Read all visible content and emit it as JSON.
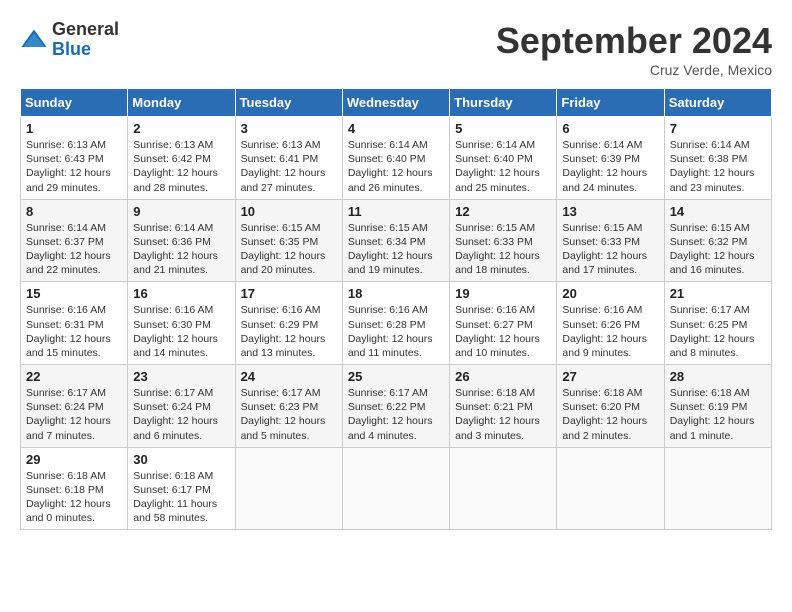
{
  "logo": {
    "general": "General",
    "blue": "Blue"
  },
  "header": {
    "month": "September 2024",
    "location": "Cruz Verde, Mexico"
  },
  "weekdays": [
    "Sunday",
    "Monday",
    "Tuesday",
    "Wednesday",
    "Thursday",
    "Friday",
    "Saturday"
  ],
  "weeks": [
    [
      {
        "day": "1",
        "sunrise": "6:13 AM",
        "sunset": "6:43 PM",
        "daylight": "12 hours and 29 minutes."
      },
      {
        "day": "2",
        "sunrise": "6:13 AM",
        "sunset": "6:42 PM",
        "daylight": "12 hours and 28 minutes."
      },
      {
        "day": "3",
        "sunrise": "6:13 AM",
        "sunset": "6:41 PM",
        "daylight": "12 hours and 27 minutes."
      },
      {
        "day": "4",
        "sunrise": "6:14 AM",
        "sunset": "6:40 PM",
        "daylight": "12 hours and 26 minutes."
      },
      {
        "day": "5",
        "sunrise": "6:14 AM",
        "sunset": "6:40 PM",
        "daylight": "12 hours and 25 minutes."
      },
      {
        "day": "6",
        "sunrise": "6:14 AM",
        "sunset": "6:39 PM",
        "daylight": "12 hours and 24 minutes."
      },
      {
        "day": "7",
        "sunrise": "6:14 AM",
        "sunset": "6:38 PM",
        "daylight": "12 hours and 23 minutes."
      }
    ],
    [
      {
        "day": "8",
        "sunrise": "6:14 AM",
        "sunset": "6:37 PM",
        "daylight": "12 hours and 22 minutes."
      },
      {
        "day": "9",
        "sunrise": "6:14 AM",
        "sunset": "6:36 PM",
        "daylight": "12 hours and 21 minutes."
      },
      {
        "day": "10",
        "sunrise": "6:15 AM",
        "sunset": "6:35 PM",
        "daylight": "12 hours and 20 minutes."
      },
      {
        "day": "11",
        "sunrise": "6:15 AM",
        "sunset": "6:34 PM",
        "daylight": "12 hours and 19 minutes."
      },
      {
        "day": "12",
        "sunrise": "6:15 AM",
        "sunset": "6:33 PM",
        "daylight": "12 hours and 18 minutes."
      },
      {
        "day": "13",
        "sunrise": "6:15 AM",
        "sunset": "6:33 PM",
        "daylight": "12 hours and 17 minutes."
      },
      {
        "day": "14",
        "sunrise": "6:15 AM",
        "sunset": "6:32 PM",
        "daylight": "12 hours and 16 minutes."
      }
    ],
    [
      {
        "day": "15",
        "sunrise": "6:16 AM",
        "sunset": "6:31 PM",
        "daylight": "12 hours and 15 minutes."
      },
      {
        "day": "16",
        "sunrise": "6:16 AM",
        "sunset": "6:30 PM",
        "daylight": "12 hours and 14 minutes."
      },
      {
        "day": "17",
        "sunrise": "6:16 AM",
        "sunset": "6:29 PM",
        "daylight": "12 hours and 13 minutes."
      },
      {
        "day": "18",
        "sunrise": "6:16 AM",
        "sunset": "6:28 PM",
        "daylight": "12 hours and 11 minutes."
      },
      {
        "day": "19",
        "sunrise": "6:16 AM",
        "sunset": "6:27 PM",
        "daylight": "12 hours and 10 minutes."
      },
      {
        "day": "20",
        "sunrise": "6:16 AM",
        "sunset": "6:26 PM",
        "daylight": "12 hours and 9 minutes."
      },
      {
        "day": "21",
        "sunrise": "6:17 AM",
        "sunset": "6:25 PM",
        "daylight": "12 hours and 8 minutes."
      }
    ],
    [
      {
        "day": "22",
        "sunrise": "6:17 AM",
        "sunset": "6:24 PM",
        "daylight": "12 hours and 7 minutes."
      },
      {
        "day": "23",
        "sunrise": "6:17 AM",
        "sunset": "6:24 PM",
        "daylight": "12 hours and 6 minutes."
      },
      {
        "day": "24",
        "sunrise": "6:17 AM",
        "sunset": "6:23 PM",
        "daylight": "12 hours and 5 minutes."
      },
      {
        "day": "25",
        "sunrise": "6:17 AM",
        "sunset": "6:22 PM",
        "daylight": "12 hours and 4 minutes."
      },
      {
        "day": "26",
        "sunrise": "6:18 AM",
        "sunset": "6:21 PM",
        "daylight": "12 hours and 3 minutes."
      },
      {
        "day": "27",
        "sunrise": "6:18 AM",
        "sunset": "6:20 PM",
        "daylight": "12 hours and 2 minutes."
      },
      {
        "day": "28",
        "sunrise": "6:18 AM",
        "sunset": "6:19 PM",
        "daylight": "12 hours and 1 minute."
      }
    ],
    [
      {
        "day": "29",
        "sunrise": "6:18 AM",
        "sunset": "6:18 PM",
        "daylight": "12 hours and 0 minutes."
      },
      {
        "day": "30",
        "sunrise": "6:18 AM",
        "sunset": "6:17 PM",
        "daylight": "11 hours and 58 minutes."
      },
      null,
      null,
      null,
      null,
      null
    ]
  ]
}
